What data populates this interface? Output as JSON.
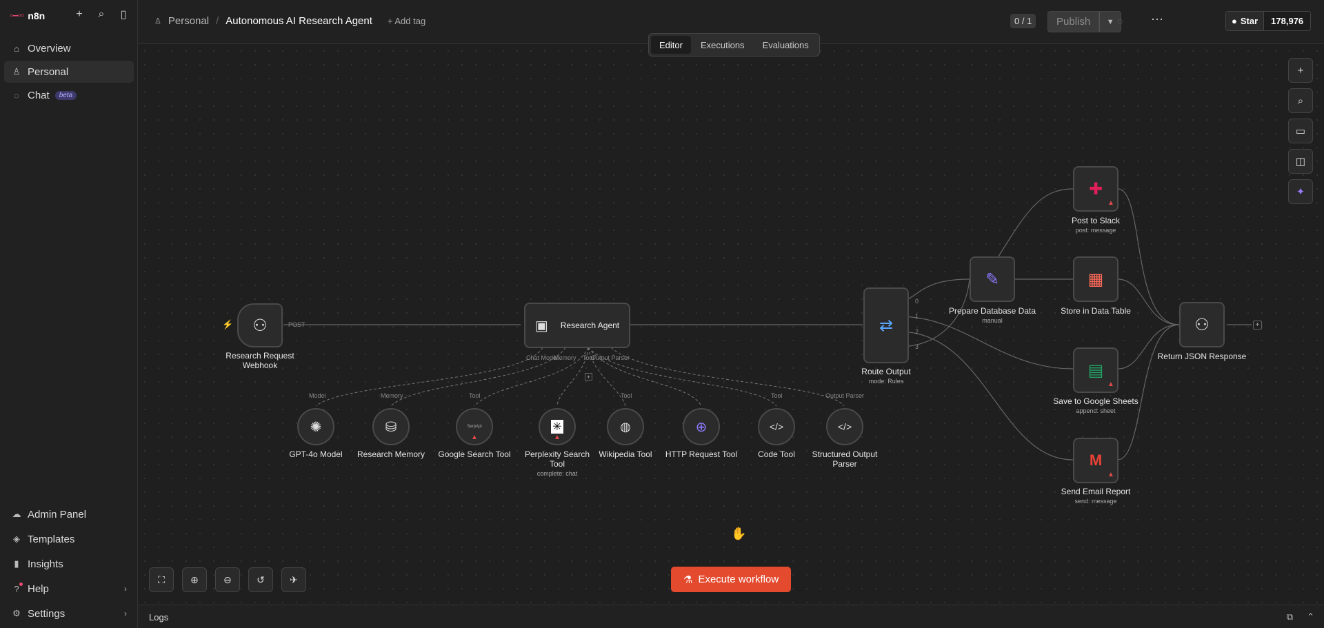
{
  "sidebar": {
    "logo": "n8n",
    "nav": [
      {
        "label": "Overview"
      },
      {
        "label": "Personal"
      },
      {
        "label": "Chat",
        "badge": "beta"
      }
    ],
    "bottom": [
      {
        "label": "Admin Panel"
      },
      {
        "label": "Templates"
      },
      {
        "label": "Insights"
      },
      {
        "label": "Help"
      },
      {
        "label": "Settings"
      }
    ]
  },
  "header": {
    "project": "Personal",
    "workflow_title": "Autonomous AI Research Agent",
    "add_tag": "+ Add tag",
    "version_counter": "0 / 1",
    "publish_label": "Publish",
    "github_star": "Star",
    "github_count": "178,976"
  },
  "tabs": [
    {
      "label": "Editor"
    },
    {
      "label": "Executions"
    },
    {
      "label": "Evaluations"
    }
  ],
  "canvas": {
    "execute_label": "Execute workflow",
    "nodes": {
      "webhook": {
        "name": "Research Request Webhook",
        "port": "POST"
      },
      "agent": {
        "name": "Research Agent",
        "ports": [
          "Chat Model",
          "Memory",
          "Tool",
          "Output Parser"
        ]
      },
      "gpt": {
        "name": "GPT-4o Model",
        "port": "Model"
      },
      "memory": {
        "name": "Research Memory",
        "port": "Memory"
      },
      "google": {
        "name": "Google Search Tool",
        "port": "Tool",
        "inner": "SerpApi"
      },
      "perplexity": {
        "name": "Perplexity Search Tool",
        "sub": "complete: chat"
      },
      "wikipedia": {
        "name": "Wikipedia Tool",
        "port": "Tool"
      },
      "http": {
        "name": "HTTP Request Tool"
      },
      "code": {
        "name": "Code Tool",
        "port": "Tool"
      },
      "parser": {
        "name": "Structured Output Parser",
        "port": "Output Parser"
      },
      "route": {
        "name": "Route Output",
        "sub": "mode: Rules",
        "ports": [
          "0",
          "1",
          "2",
          "3"
        ]
      },
      "prepare": {
        "name": "Prepare Database Data",
        "sub": "manual"
      },
      "slack": {
        "name": "Post to Slack",
        "sub": "post: message"
      },
      "table": {
        "name": "Store in Data Table"
      },
      "sheets": {
        "name": "Save to Google Sheets",
        "sub": "append: sheet"
      },
      "email": {
        "name": "Send Email Report",
        "sub": "send: message"
      },
      "respond": {
        "name": "Return JSON Response"
      }
    }
  },
  "logs": {
    "label": "Logs"
  },
  "colors": {
    "accent": "#ea4b71",
    "execute": "#e34a2e",
    "warning": "#e34a4a"
  }
}
